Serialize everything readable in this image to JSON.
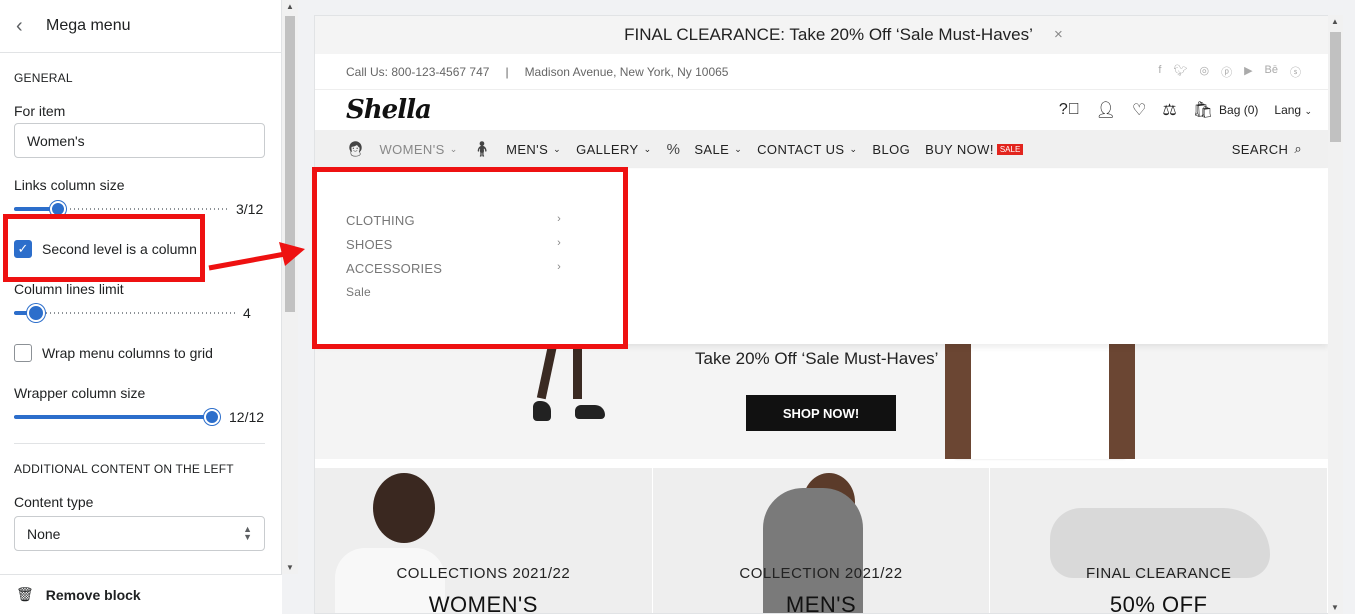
{
  "panel": {
    "title": "Mega menu",
    "general_heading": "GENERAL",
    "for_item_label": "For item",
    "for_item_value": "Women's",
    "links_col_label": "Links column size",
    "links_col_value": "3/12",
    "links_col_level": 0.25,
    "second_level_label": "Second level is a column",
    "second_level_checked": true,
    "col_lines_label": "Column lines limit",
    "col_lines_value": "4",
    "wrap_label": "Wrap menu columns to grid",
    "wrapper_label": "Wrapper column size",
    "wrapper_value": "12/12",
    "additional_heading": "ADDITIONAL CONTENT ON THE LEFT",
    "content_type_label": "Content type",
    "content_type_value": "None",
    "remove_label": "Remove block"
  },
  "preview": {
    "announcement": "FINAL CLEARANCE: Take 20% Off ‘Sale Must-Haves’",
    "close_glyph": "×",
    "phone": "Call Us: 800-123-4567 747",
    "separator": "|",
    "address": "Madison Avenue, New York, Ny 10065",
    "social_icons": [
      "facebook-icon",
      "twitter-icon",
      "instagram-icon",
      "pinterest-icon",
      "youtube-icon",
      "behance-icon",
      "skype-icon"
    ],
    "logo": "Shella",
    "bag": "Bag (0)",
    "lang": "Lang",
    "nav": {
      "womens": "WOMEN'S",
      "mens": "MEN'S",
      "gallery": "GALLERY",
      "sale": "SALE",
      "contact": "CONTACT US",
      "blog": "BLOG",
      "buy": "BUY NOW!",
      "sale_badge": "SALE",
      "search": "SEARCH"
    },
    "mega": {
      "items": [
        "CLOTHING",
        "SHOES",
        "ACCESSORIES",
        "Sale"
      ]
    },
    "hero": {
      "title": "Take 20% Off ‘Sale Must-Haves’",
      "button": "SHOP NOW!"
    },
    "categories": [
      {
        "kicker": "COLLECTIONS 2021/22",
        "title": "WOMEN'S"
      },
      {
        "kicker": "COLLECTION 2021/22",
        "title": "MEN'S"
      },
      {
        "kicker": "FINAL CLEARANCE",
        "title": "50% OFF"
      }
    ]
  },
  "colors": {
    "accent": "#2c6ecb",
    "annotation": "#ee1111",
    "sale_badge": "#e2251e"
  }
}
